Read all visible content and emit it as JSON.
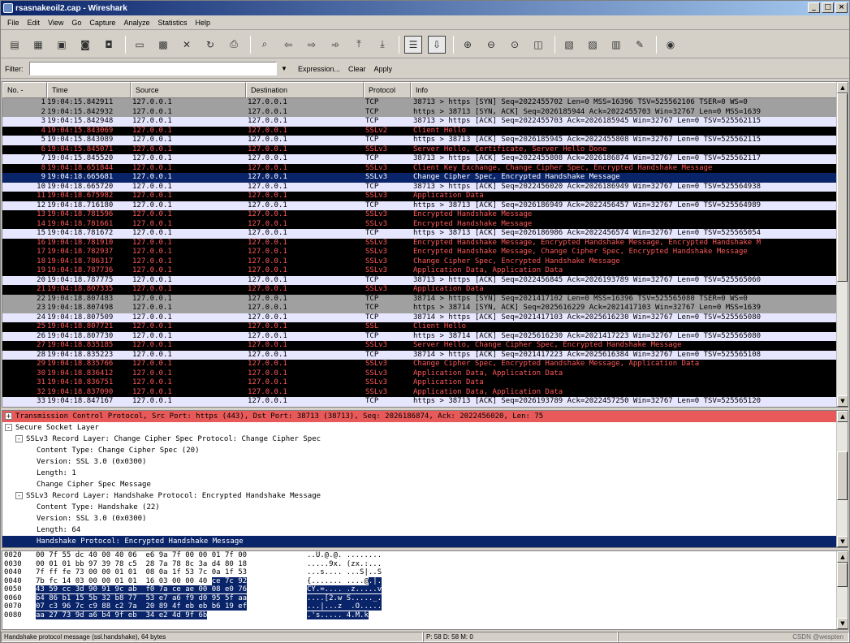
{
  "window": {
    "title": "rsasnakeoil2.cap - Wireshark",
    "buttons": [
      "_",
      "□",
      "×"
    ]
  },
  "menu": [
    "File",
    "Edit",
    "View",
    "Go",
    "Capture",
    "Analyze",
    "Statistics",
    "Help"
  ],
  "toolbar": [
    {
      "icon": "interfaces-icon",
      "glyph": "▤",
      "sep_after": false
    },
    {
      "icon": "capture-options-icon",
      "glyph": "▦",
      "sep_after": false
    },
    {
      "icon": "start-capture-icon",
      "glyph": "▣",
      "sep_after": false
    },
    {
      "icon": "stop-capture-icon",
      "glyph": "◙",
      "sep_after": false
    },
    {
      "icon": "restart-capture-icon",
      "glyph": "◘",
      "sep_after": true
    },
    {
      "icon": "open-file-icon",
      "glyph": "▭",
      "sep_after": false
    },
    {
      "icon": "save-file-icon",
      "glyph": "▩",
      "sep_after": false
    },
    {
      "icon": "close-file-icon",
      "glyph": "✕",
      "sep_after": false
    },
    {
      "icon": "reload-icon",
      "glyph": "↻",
      "sep_after": false
    },
    {
      "icon": "print-icon",
      "glyph": "⎙",
      "sep_after": true
    },
    {
      "icon": "find-packet-icon",
      "glyph": "⌕",
      "sep_after": false
    },
    {
      "icon": "go-back-icon",
      "glyph": "⇦",
      "sep_after": false
    },
    {
      "icon": "go-forward-icon",
      "glyph": "⇨",
      "sep_after": false
    },
    {
      "icon": "go-to-packet-icon",
      "glyph": "➾",
      "sep_after": false
    },
    {
      "icon": "go-first-icon",
      "glyph": "⤒",
      "sep_after": false
    },
    {
      "icon": "go-last-icon",
      "glyph": "⤓",
      "sep_after": true
    },
    {
      "icon": "colorize-icon",
      "glyph": "☰",
      "active": true,
      "sep_after": false
    },
    {
      "icon": "auto-scroll-icon",
      "glyph": "⇩",
      "active": true,
      "sep_after": true
    },
    {
      "icon": "zoom-in-icon",
      "glyph": "⊕",
      "sep_after": false
    },
    {
      "icon": "zoom-out-icon",
      "glyph": "⊖",
      "sep_after": false
    },
    {
      "icon": "zoom-normal-icon",
      "glyph": "⊙",
      "sep_after": false
    },
    {
      "icon": "resize-columns-icon",
      "glyph": "◫",
      "sep_after": true
    },
    {
      "icon": "capture-filters-icon",
      "glyph": "▧",
      "sep_after": false
    },
    {
      "icon": "display-filters-icon",
      "glyph": "▨",
      "sep_after": false
    },
    {
      "icon": "coloring-rules-icon",
      "glyph": "▥",
      "sep_after": false
    },
    {
      "icon": "preferences-icon",
      "glyph": "✎",
      "sep_after": true
    },
    {
      "icon": "help-icon",
      "glyph": "◉",
      "sep_after": false
    }
  ],
  "filter": {
    "label": "Filter:",
    "value": "",
    "expression_label": "Expression...",
    "clear_label": "Clear",
    "apply_label": "Apply"
  },
  "packet_list": {
    "columns": [
      "No. -",
      "Time",
      "Source",
      "Destination",
      "Protocol",
      "Info"
    ],
    "colors": {
      "gray": [
        "#a0a0a0",
        "#000000"
      ],
      "lav": [
        "#e7e6ff",
        "#000000"
      ],
      "black": [
        "#000000",
        "#ff5757"
      ],
      "sel": [
        "#0a246a",
        "#ffffff"
      ]
    },
    "rows": [
      {
        "no": "1",
        "time": "19:04:15.842911",
        "src": "127.0.0.1",
        "dst": "127.0.0.1",
        "proto": "TCP",
        "info": "38713 > https [SYN] Seq=2022455702 Len=0 MSS=16396 TSV=525562106 TSER=0 WS=0",
        "style": "gray"
      },
      {
        "no": "2",
        "time": "19:04:15.842932",
        "src": "127.0.0.1",
        "dst": "127.0.0.1",
        "proto": "TCP",
        "info": "https > 38713 [SYN, ACK] Seq=2026185944 Ack=2022455703 Win=32767 Len=0 MSS=1639",
        "style": "gray"
      },
      {
        "no": "3",
        "time": "19:04:15.842948",
        "src": "127.0.0.1",
        "dst": "127.0.0.1",
        "proto": "TCP",
        "info": "38713 > https [ACK] Seq=2022455703 Ack=2026185945 Win=32767 Len=0 TSV=525562115",
        "style": "lav"
      },
      {
        "no": "4",
        "time": "19:04:15.843069",
        "src": "127.0.0.1",
        "dst": "127.0.0.1",
        "proto": "SSLv2",
        "info": "Client Hello",
        "style": "black"
      },
      {
        "no": "5",
        "time": "19:04:15.843089",
        "src": "127.0.0.1",
        "dst": "127.0.0.1",
        "proto": "TCP",
        "info": "https > 38713 [ACK] Seq=2026185945 Ack=2022455808 Win=32767 Len=0 TSV=525562115",
        "style": "lav"
      },
      {
        "no": "6",
        "time": "19:04:15.845071",
        "src": "127.0.0.1",
        "dst": "127.0.0.1",
        "proto": "SSLv3",
        "info": "Server Hello, Certificate, Server Hello Done",
        "style": "black"
      },
      {
        "no": "7",
        "time": "19:04:15.845520",
        "src": "127.0.0.1",
        "dst": "127.0.0.1",
        "proto": "TCP",
        "info": "38713 > https [ACK] Seq=2022455808 Ack=2026186874 Win=32767 Len=0 TSV=525562117",
        "style": "lav"
      },
      {
        "no": "8",
        "time": "19:04:18.651844",
        "src": "127.0.0.1",
        "dst": "127.0.0.1",
        "proto": "SSLv3",
        "info": "Client Key Exchange, Change Cipher Spec, Encrypted Handshake Message",
        "style": "black"
      },
      {
        "no": "9",
        "time": "19:04:18.665681",
        "src": "127.0.0.1",
        "dst": "127.0.0.1",
        "proto": "SSLv3",
        "info": "Change Cipher Spec, Encrypted Handshake Message",
        "style": "sel"
      },
      {
        "no": "10",
        "time": "19:04:18.665720",
        "src": "127.0.0.1",
        "dst": "127.0.0.1",
        "proto": "TCP",
        "info": "38713 > https [ACK] Seq=2022456020 Ack=2026186949 Win=32767 Len=0 TSV=525564938",
        "style": "lav"
      },
      {
        "no": "11",
        "time": "19:04:18.675982",
        "src": "127.0.0.1",
        "dst": "127.0.0.1",
        "proto": "SSLv3",
        "info": "Application Data",
        "style": "black"
      },
      {
        "no": "12",
        "time": "19:04:18.716180",
        "src": "127.0.0.1",
        "dst": "127.0.0.1",
        "proto": "TCP",
        "info": "https > 38713 [ACK] Seq=2026186949 Ack=2022456457 Win=32767 Len=0 TSV=525564989",
        "style": "lav"
      },
      {
        "no": "13",
        "time": "19:04:18.781596",
        "src": "127.0.0.1",
        "dst": "127.0.0.1",
        "proto": "SSLv3",
        "info": "Encrypted Handshake Message",
        "style": "black"
      },
      {
        "no": "14",
        "time": "19:04:18.781661",
        "src": "127.0.0.1",
        "dst": "127.0.0.1",
        "proto": "SSLv3",
        "info": "Encrypted Handshake Message",
        "style": "black"
      },
      {
        "no": "15",
        "time": "19:04:18.781672",
        "src": "127.0.0.1",
        "dst": "127.0.0.1",
        "proto": "TCP",
        "info": "https > 38713 [ACK] Seq=2026186986 Ack=2022456574 Win=32767 Len=0 TSV=525565054",
        "style": "lav"
      },
      {
        "no": "16",
        "time": "19:04:18.781910",
        "src": "127.0.0.1",
        "dst": "127.0.0.1",
        "proto": "SSLv3",
        "info": "Encrypted Handshake Message, Encrypted Handshake Message, Encrypted Handshake M",
        "style": "black"
      },
      {
        "no": "17",
        "time": "19:04:18.782937",
        "src": "127.0.0.1",
        "dst": "127.0.0.1",
        "proto": "SSLv3",
        "info": "Encrypted Handshake Message, Change Cipher Spec, Encrypted Handshake Message",
        "style": "black"
      },
      {
        "no": "18",
        "time": "19:04:18.786317",
        "src": "127.0.0.1",
        "dst": "127.0.0.1",
        "proto": "SSLv3",
        "info": "Change Cipher Spec, Encrypted Handshake Message",
        "style": "black"
      },
      {
        "no": "19",
        "time": "19:04:18.787736",
        "src": "127.0.0.1",
        "dst": "127.0.0.1",
        "proto": "SSLv3",
        "info": "Application Data, Application Data",
        "style": "black"
      },
      {
        "no": "20",
        "time": "19:04:18.787775",
        "src": "127.0.0.1",
        "dst": "127.0.0.1",
        "proto": "TCP",
        "info": "38713 > https [ACK] Seq=2022456845 Ack=2026193789 Win=32767 Len=0 TSV=525565060",
        "style": "lav"
      },
      {
        "no": "21",
        "time": "19:04:18.807335",
        "src": "127.0.0.1",
        "dst": "127.0.0.1",
        "proto": "SSLv3",
        "info": "Application Data",
        "style": "black"
      },
      {
        "no": "22",
        "time": "19:04:18.807483",
        "src": "127.0.0.1",
        "dst": "127.0.0.1",
        "proto": "TCP",
        "info": "38714 > https [SYN] Seq=2021417102 Len=0 MSS=16396 TSV=525565080 TSER=0 WS=0",
        "style": "gray"
      },
      {
        "no": "23",
        "time": "19:04:18.807498",
        "src": "127.0.0.1",
        "dst": "127.0.0.1",
        "proto": "TCP",
        "info": "https > 38714 [SYN, ACK] Seq=2025616229 Ack=2021417103 Win=32767 Len=0 MSS=1639",
        "style": "gray"
      },
      {
        "no": "24",
        "time": "19:04:18.807509",
        "src": "127.0.0.1",
        "dst": "127.0.0.1",
        "proto": "TCP",
        "info": "38714 > https [ACK] Seq=2021417103 Ack=2025616230 Win=32767 Len=0 TSV=525565080",
        "style": "lav"
      },
      {
        "no": "25",
        "time": "19:04:18.807721",
        "src": "127.0.0.1",
        "dst": "127.0.0.1",
        "proto": "SSL",
        "info": "Client Hello",
        "style": "black"
      },
      {
        "no": "26",
        "time": "19:04:18.807730",
        "src": "127.0.0.1",
        "dst": "127.0.0.1",
        "proto": "TCP",
        "info": "https > 38714 [ACK] Seq=2025616230 Ack=2021417223 Win=32767 Len=0 TSV=525565080",
        "style": "lav"
      },
      {
        "no": "27",
        "time": "19:04:18.835185",
        "src": "127.0.0.1",
        "dst": "127.0.0.1",
        "proto": "SSLv3",
        "info": "Server Hello, Change Cipher Spec, Encrypted Handshake Message",
        "style": "black"
      },
      {
        "no": "28",
        "time": "19:04:18.835223",
        "src": "127.0.0.1",
        "dst": "127.0.0.1",
        "proto": "TCP",
        "info": "38714 > https [ACK] Seq=2021417223 Ack=2025616384 Win=32767 Len=0 TSV=525565108",
        "style": "lav"
      },
      {
        "no": "29",
        "time": "19:04:18.835766",
        "src": "127.0.0.1",
        "dst": "127.0.0.1",
        "proto": "SSLv3",
        "info": "Change Cipher Spec, Encrypted Handshake Message, Application Data",
        "style": "black"
      },
      {
        "no": "30",
        "time": "19:04:18.836412",
        "src": "127.0.0.1",
        "dst": "127.0.0.1",
        "proto": "SSLv3",
        "info": "Application Data, Application Data",
        "style": "black"
      },
      {
        "no": "31",
        "time": "19:04:18.836751",
        "src": "127.0.0.1",
        "dst": "127.0.0.1",
        "proto": "SSLv3",
        "info": "Application Data",
        "style": "black"
      },
      {
        "no": "32",
        "time": "19:04:18.837090",
        "src": "127.0.0.1",
        "dst": "127.0.0.1",
        "proto": "SSLv3",
        "info": "Application Data, Application Data",
        "style": "black"
      },
      {
        "no": "33",
        "time": "19:04:18.847167",
        "src": "127.0.0.1",
        "dst": "127.0.0.1",
        "proto": "TCP",
        "info": "https > 38713 [ACK] Seq=2026193789 Ack=2022457250 Win=32767 Len=0 TSV=525565120",
        "style": "lav"
      }
    ]
  },
  "details": {
    "rows": [
      {
        "indent": 0,
        "toggle": "+",
        "text": "Transmission Control Protocol, Src Port: https (443), Dst Port: 38713 (38713), Seq: 2026186874, Ack: 2022456020, Len: 75",
        "style": "tcp"
      },
      {
        "indent": 0,
        "toggle": "-",
        "text": "Secure Socket Layer",
        "style": "normal"
      },
      {
        "indent": 1,
        "toggle": "-",
        "text": "SSLv3 Record Layer: Change Cipher Spec Protocol: Change Cipher Spec",
        "style": "normal"
      },
      {
        "indent": 2,
        "toggle": "",
        "text": "Content Type: Change Cipher Spec (20)",
        "style": "normal"
      },
      {
        "indent": 2,
        "toggle": "",
        "text": "Version: SSL 3.0 (0x0300)",
        "style": "normal"
      },
      {
        "indent": 2,
        "toggle": "",
        "text": "Length: 1",
        "style": "normal"
      },
      {
        "indent": 2,
        "toggle": "",
        "text": "Change Cipher Spec Message",
        "style": "normal"
      },
      {
        "indent": 1,
        "toggle": "-",
        "text": "SSLv3 Record Layer: Handshake Protocol: Encrypted Handshake Message",
        "style": "normal"
      },
      {
        "indent": 2,
        "toggle": "",
        "text": "Content Type: Handshake (22)",
        "style": "normal"
      },
      {
        "indent": 2,
        "toggle": "",
        "text": "Version: SSL 3.0 (0x0300)",
        "style": "normal"
      },
      {
        "indent": 2,
        "toggle": "",
        "text": "Length: 64",
        "style": "normal"
      },
      {
        "indent": 2,
        "toggle": "",
        "text": "Handshake Protocol: Encrypted Handshake Message",
        "style": "sel"
      }
    ]
  },
  "hex": {
    "rows": [
      {
        "off": "0020",
        "a": "00 7f 55 dc 40 00 40 06  e6 9a 7f 00 00 01 7f 00",
        "b": "",
        "asc_a": "..U.@.@. ........",
        "asc_b": ""
      },
      {
        "off": "0030",
        "a": "00 01 01 bb 97 39 78 c5  28 7a 78 8c 3a d4 80 18",
        "b": "",
        "asc_a": ".....9x. (zx.:...",
        "asc_b": ""
      },
      {
        "off": "0040",
        "a": "7f ff fe 73 00 00 01 01  08 0a 1f 53 7c 0a 1f 53",
        "b": "",
        "asc_a": "...s.... ...S|..S",
        "asc_b": ""
      },
      {
        "off": "0040",
        "a": "7b fc 14 03 00 00 01 01  16 03 00 00 40 ",
        "b": "ce 7c 92",
        "asc_a": "{....... ....@",
        "asc_b": ".|."
      },
      {
        "off": "0050",
        "a": "",
        "b": "43 59 cc 3d 90 91 9c ab  f0 7a ce ae 00 08 e0 76",
        "asc_a": "",
        "asc_b": "CY.=.... .z.....v"
      },
      {
        "off": "0060",
        "a": "",
        "b": "b4 86 b1 15 5b 32 b8 77  53 e7 a6 f9 d0 95 5f aa",
        "asc_a": "",
        "asc_b": "....[2.w S....._."
      },
      {
        "off": "0070",
        "a": "",
        "b": "07 c3 96 7c c9 88 c2 7a  20 89 4f eb eb b6 19 ef",
        "asc_a": "",
        "asc_b": "...|...z  .O....."
      },
      {
        "off": "0080",
        "a": "",
        "b": "aa 27 73 9d a6 b4 9f eb  34 e2 4d 9f 6b",
        "asc_a": "",
        "asc_b": ".'s..... 4.M.k"
      }
    ]
  },
  "status": {
    "left": "Handshake protocol message (ssl.handshake), 64 bytes",
    "middle": "P: 58 D: 58 M: 0",
    "right": "",
    "watermark": "CSDN @wespten"
  }
}
